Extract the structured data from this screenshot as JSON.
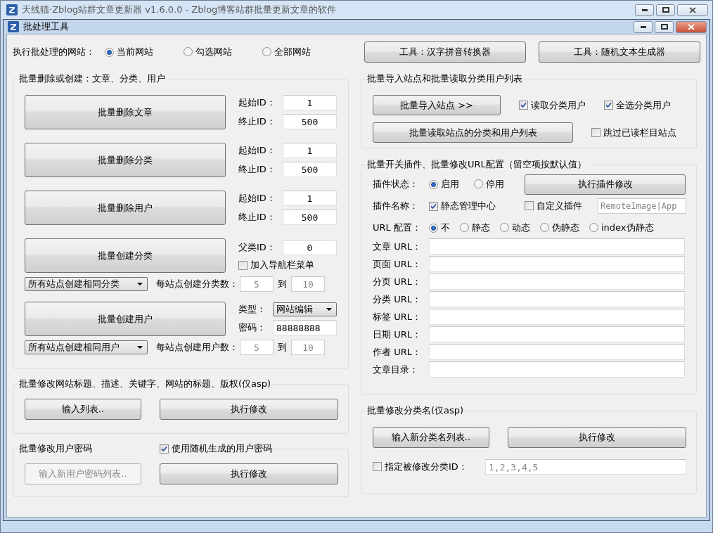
{
  "main_window": {
    "title": "天线猫·Zblog站群文章更新器 v1.6.0.0 - Zblog博客站群批量更新文章的软件"
  },
  "dialog": {
    "title": "批处理工具"
  },
  "target": {
    "label": "执行批处理的网站：",
    "options": [
      {
        "label": "当前网站",
        "selected": true
      },
      {
        "label": "勾选网站",
        "selected": false
      },
      {
        "label": "全部网站",
        "selected": false
      }
    ]
  },
  "tool_buttons": [
    "工具：汉字拼音转换器",
    "工具：随机文本生成器"
  ],
  "batch_group": {
    "title": "批量删除或创建：文章、分类、用户",
    "delete_rows": [
      {
        "button": "批量删除文章",
        "start_label": "起始ID：",
        "start": "1",
        "end_label": "终止ID：",
        "end": "500"
      },
      {
        "button": "批量删除分类",
        "start_label": "起始ID：",
        "start": "1",
        "end_label": "终止ID：",
        "end": "500"
      },
      {
        "button": "批量删除用户",
        "start_label": "起始ID：",
        "start": "1",
        "end_label": "终止ID：",
        "end": "500"
      }
    ],
    "create_category": {
      "button": "批量创建分类",
      "parent_label": "父类ID：",
      "parent": "0",
      "nav_menu": {
        "label": "加入导航栏菜单",
        "checked": false
      },
      "mode": "所有站点创建相同分类",
      "count_label": "每站点创建分类数：",
      "from": "5",
      "to_label": "到",
      "to": "10"
    },
    "create_user": {
      "button": "批量创建用户",
      "type_label": "类型：",
      "type": "网站编辑",
      "password_label": "密码：",
      "password": "88888888",
      "mode": "所有站点创建相同用户",
      "count_label": "每站点创建用户数：",
      "from": "5",
      "to_label": "到",
      "to": "10"
    }
  },
  "site_info_group": {
    "title": "批量修改网站标题、描述、关键字、网站的标题、版权(仅asp)",
    "list_button": "输入列表..",
    "run_button": "执行修改"
  },
  "password_group": {
    "title": "批量修改用户密码",
    "random": {
      "label": "使用随机生成的用户密码",
      "checked": true
    },
    "list_button": {
      "label": "输入新用户密码列表..",
      "disabled": true
    },
    "run_button": "执行修改"
  },
  "import_group": {
    "title": "批量导入站点和批量读取分类用户列表",
    "import_button": "批量导入站点 >>",
    "read_button": "批量读取站点的分类和用户列表",
    "read_option": {
      "label": "读取分类用户",
      "checked": true
    },
    "all_option": {
      "label": "全选分类用户",
      "checked": true
    },
    "skip_option": {
      "label": "跳过已读栏目站点",
      "checked": false
    }
  },
  "plugin_group": {
    "title": "批量开关插件、批量修改URL配置（留空项按默认值）",
    "status_label": "插件状态：",
    "status_options": [
      {
        "label": "启用",
        "selected": true
      },
      {
        "label": "停用",
        "selected": false
      }
    ],
    "run_button": "执行插件修改",
    "name_label": "插件名称：",
    "static_plugin": {
      "label": "静态管理中心",
      "checked": true
    },
    "custom_plugin": {
      "label": "自定义插件",
      "checked": false
    },
    "custom_value": "RemoteImage|App",
    "url_label": "URL 配置：",
    "url_options": [
      {
        "label": "不",
        "selected": true
      },
      {
        "label": "静态",
        "selected": false
      },
      {
        "label": "动态",
        "selected": false
      },
      {
        "label": "伪静态",
        "selected": false
      },
      {
        "label": "index伪静态",
        "selected": false
      }
    ],
    "url_fields": [
      {
        "label": "文章 URL："
      },
      {
        "label": "页面 URL："
      },
      {
        "label": "分页 URL："
      },
      {
        "label": "分类 URL："
      },
      {
        "label": "标签 URL："
      },
      {
        "label": "日期 URL："
      },
      {
        "label": "作者 URL："
      },
      {
        "label": "文章目录："
      }
    ]
  },
  "category_group": {
    "title": "批量修改分类名(仅asp)",
    "list_button": "输入新分类名列表..",
    "run_button": "执行修改",
    "specify": {
      "label": "指定被修改分类ID：",
      "checked": false
    },
    "ids_placeholder": "1,2,3,4,5"
  }
}
